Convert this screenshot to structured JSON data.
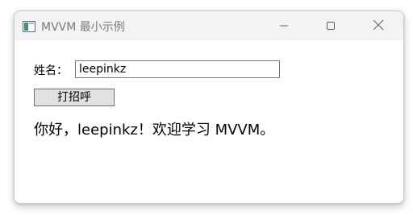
{
  "window": {
    "title": "MVVM 最小示例",
    "icon": "app-window-icon",
    "controls": {
      "minimize_icon": "minimize-icon",
      "maximize_icon": "maximize-icon",
      "close_icon": "close-icon"
    }
  },
  "form": {
    "name_label": "姓名：",
    "name_value": "leepinkz",
    "greet_button_label": "打招呼",
    "greeting_text": "你好，leepinkz！欢迎学习 MVVM。"
  },
  "colors": {
    "titlebar_bg": "#f3f3f3",
    "title_text": "#7a7a7a",
    "button_bg": "#e1e1e1",
    "input_border": "#7a7a7a"
  }
}
